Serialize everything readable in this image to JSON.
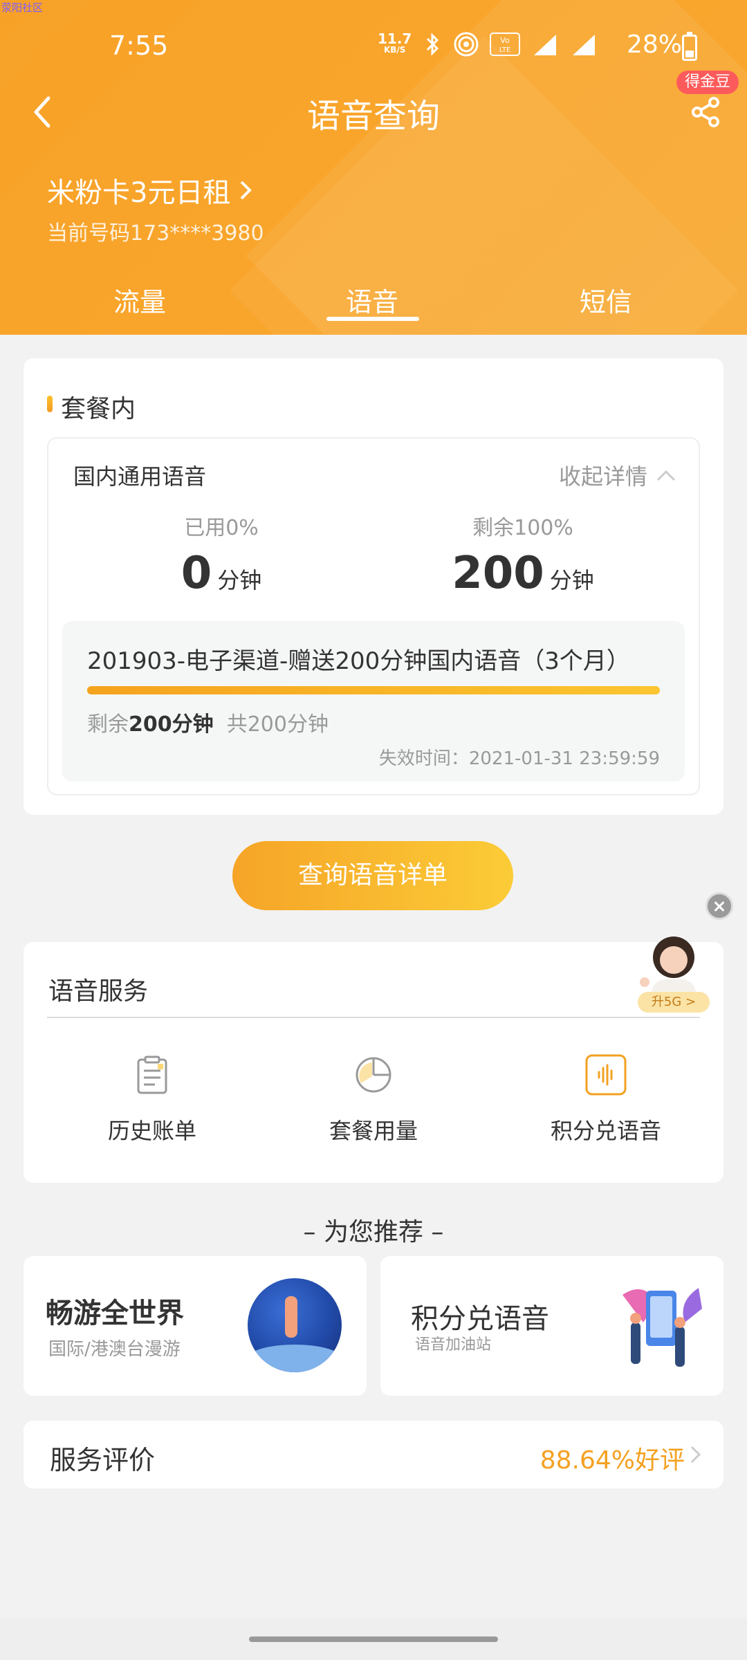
{
  "watermark": "荥阳社区",
  "status_bar": {
    "time": "7:55",
    "net_speed_value": "11.7",
    "net_speed_unit": "KB/S",
    "battery_pct": "28%"
  },
  "nav": {
    "title": "语音查询",
    "gold_badge": "得金豆"
  },
  "account": {
    "plan_name": "米粉卡3元日租",
    "phone": "当前号码173****3980"
  },
  "tabs": [
    {
      "label": "流量"
    },
    {
      "label": "语音"
    },
    {
      "label": "短信"
    }
  ],
  "plan_section": {
    "title": "套餐内",
    "voice_label": "国内通用语音",
    "collapse_label": "收起详情",
    "used_label": "已用0%",
    "used_value": "0",
    "remain_label": "剩余100%",
    "remain_value": "200",
    "unit": "分钟",
    "package": {
      "title": "201903-电子渠道-赠送200分钟国内语音（3个月）",
      "progress": 1.0,
      "remain_prefix": "剩余",
      "remain_amount": "200分钟",
      "total": "共200分钟",
      "expire": "失效时间：2021-01-31 23:59:59"
    }
  },
  "query_button": "查询语音详单",
  "float_badge": "升5G >",
  "services": {
    "title": "语音服务",
    "items": [
      {
        "label": "历史账单",
        "icon": "bill-icon"
      },
      {
        "label": "套餐用量",
        "icon": "pie-chart-icon"
      },
      {
        "label": "积分兑语音",
        "icon": "voice-wave-icon"
      }
    ]
  },
  "recommend": {
    "title": "– 为您推荐 –",
    "cards": [
      {
        "name": "畅游全世界",
        "sub": "国际/港澳台漫游"
      },
      {
        "name": "积分兑语音",
        "sub": "语音加油站"
      }
    ]
  },
  "rating": {
    "label": "服务评价",
    "value": "88.64%好评"
  },
  "colors": {
    "brand_orange": "#f7a127",
    "accent_text": "#f3a121",
    "badge_red": "#fd5b5b"
  }
}
